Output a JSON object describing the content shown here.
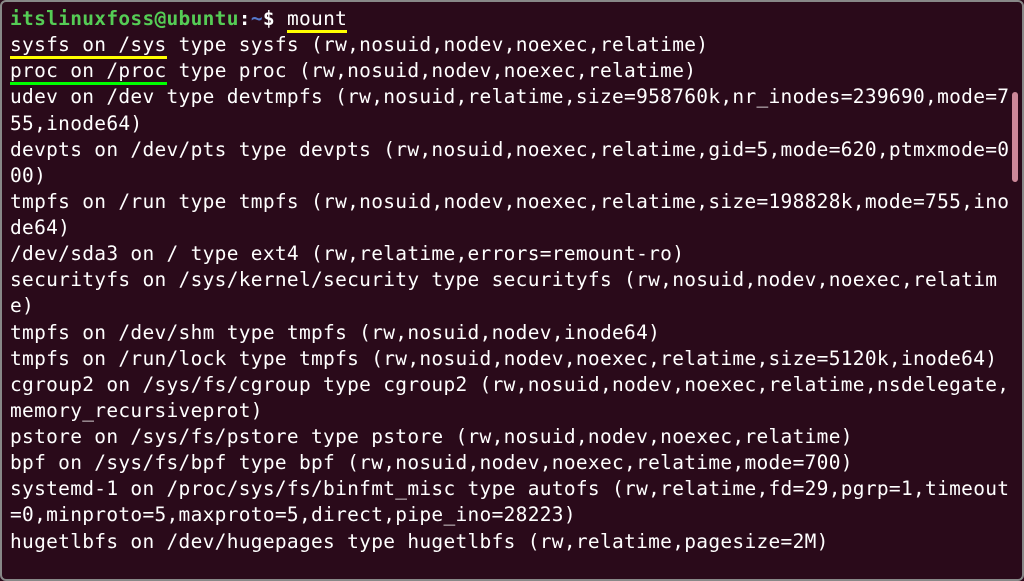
{
  "prompt": {
    "user_host": "itslinuxfoss@ubuntu",
    "colon": ":",
    "path": "~",
    "dollar": "$ ",
    "command": "mount"
  },
  "lines": {
    "l0_pre": "sysfs on /sys",
    "l0_post": " type sysfs (rw,nosuid,nodev,noexec,relatime)",
    "l1_pre": "proc on /proc",
    "l1_post": " type proc (rw,nosuid,nodev,noexec,relatime)",
    "l2": "udev on /dev type devtmpfs (rw,nosuid,relatime,size=958760k,nr_inodes=239690,mode=755,inode64)",
    "l3": "devpts on /dev/pts type devpts (rw,nosuid,noexec,relatime,gid=5,mode=620,ptmxmode=000)",
    "l4": "tmpfs on /run type tmpfs (rw,nosuid,nodev,noexec,relatime,size=198828k,mode=755,inode64)",
    "l5": "/dev/sda3 on / type ext4 (rw,relatime,errors=remount-ro)",
    "l6": "securityfs on /sys/kernel/security type securityfs (rw,nosuid,nodev,noexec,relatime)",
    "l7": "tmpfs on /dev/shm type tmpfs (rw,nosuid,nodev,inode64)",
    "l8": "tmpfs on /run/lock type tmpfs (rw,nosuid,nodev,noexec,relatime,size=5120k,inode64)",
    "l9": "cgroup2 on /sys/fs/cgroup type cgroup2 (rw,nosuid,nodev,noexec,relatime,nsdelegate,memory_recursiveprot)",
    "l10": "pstore on /sys/fs/pstore type pstore (rw,nosuid,nodev,noexec,relatime)",
    "l11": "bpf on /sys/fs/bpf type bpf (rw,nosuid,nodev,noexec,relatime,mode=700)",
    "l12": "systemd-1 on /proc/sys/fs/binfmt_misc type autofs (rw,relatime,fd=29,pgrp=1,timeout=0,minproto=5,maxproto=5,direct,pipe_ino=28223)",
    "l13": "hugetlbfs on /dev/hugepages type hugetlbfs (rw,relatime,pagesize=2M)"
  }
}
